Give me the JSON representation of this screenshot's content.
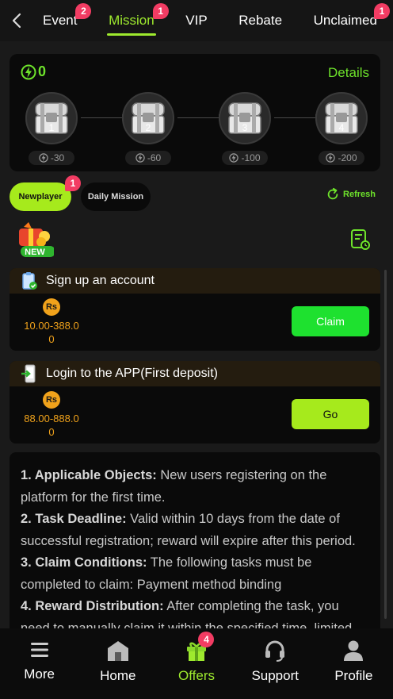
{
  "tabs": [
    {
      "label": "Event",
      "badge": "2"
    },
    {
      "label": "Mission",
      "badge": "1",
      "active": true
    },
    {
      "label": "VIP",
      "badge": ""
    },
    {
      "label": "Rebate",
      "badge": ""
    },
    {
      "label": "Unclaimed",
      "badge": "1"
    }
  ],
  "points": {
    "value": "0",
    "details_label": "Details"
  },
  "chests": [
    {
      "number": "1",
      "cost": "-30"
    },
    {
      "number": "2",
      "cost": "-60"
    },
    {
      "number": "3",
      "cost": "-100"
    },
    {
      "number": "4",
      "cost": "-200"
    }
  ],
  "subtabs": {
    "newplayer": "Newplayer",
    "newplayer_badge": "1",
    "daily": "Daily Mission",
    "refresh": "Refresh"
  },
  "new_icon_text": "NEW",
  "tasks": [
    {
      "title": "Sign up an account",
      "currency": "Rs",
      "amount_line1": "10.00-388.0",
      "amount_line2": "0",
      "button": "Claim"
    },
    {
      "title": "Login to the APP(First deposit)",
      "currency": "Rs",
      "amount_line1": "88.00-888.0",
      "amount_line2": "0",
      "button": "Go"
    }
  ],
  "rules": [
    {
      "heading": "1. Applicable Objects:",
      "text": " New users registering on the platform for the first time."
    },
    {
      "heading": "2. Task Deadline:",
      "text": " Valid within 10 days from the date of successful registration; reward will expire after this period."
    },
    {
      "heading": "3. Claim Conditions:",
      "text": " The following tasks must be completed to claim: Payment method binding"
    },
    {
      "heading": "4. Reward Distribution:",
      "text": " After completing the task, you need to manually claim it within the specified time, limited"
    }
  ],
  "nav": [
    {
      "label": "More",
      "icon": "menu-icon"
    },
    {
      "label": "Home",
      "icon": "home-icon"
    },
    {
      "label": "Offers",
      "icon": "gift-icon",
      "badge": "4",
      "active": true
    },
    {
      "label": "Support",
      "icon": "headset-icon"
    },
    {
      "label": "Profile",
      "icon": "profile-icon"
    }
  ],
  "colors": {
    "accent": "#9eea2e",
    "badge": "#f23c63",
    "claim": "#1ee12f",
    "go": "#a6ea1c",
    "currency": "#f0a21b"
  }
}
